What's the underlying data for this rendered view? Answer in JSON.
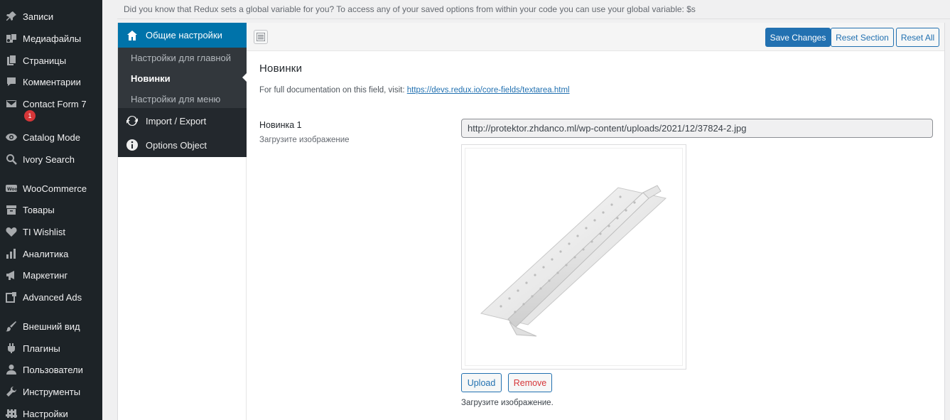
{
  "notice": {
    "text": "Did you know that Redux sets a global variable for you? To access any of your saved options from within your code you can use your global variable: $s"
  },
  "wp_menu": {
    "items": [
      {
        "label": "Записи",
        "icon": "pin-icon"
      },
      {
        "label": "Медиафайлы",
        "icon": "media-icon"
      },
      {
        "label": "Страницы",
        "icon": "page-icon"
      },
      {
        "label": "Комментарии",
        "icon": "comment-icon"
      },
      {
        "label": "Contact Form 7",
        "icon": "envelope-icon",
        "badge": "1"
      },
      {
        "label": "Catalog Mode",
        "icon": "eye-icon"
      },
      {
        "label": "Ivory Search",
        "icon": "search-icon"
      },
      {
        "label": "WooCommerce",
        "icon": "woo-icon"
      },
      {
        "label": "Товары",
        "icon": "archive-icon"
      },
      {
        "label": "TI Wishlist",
        "icon": "heart-icon"
      },
      {
        "label": "Аналитика",
        "icon": "bar-chart-icon"
      },
      {
        "label": "Маркетинг",
        "icon": "megaphone-icon"
      },
      {
        "label": "Advanced Ads",
        "icon": "ads-icon"
      },
      {
        "label": "Внешний вид",
        "icon": "brush-icon"
      },
      {
        "label": "Плагины",
        "icon": "plugin-icon"
      },
      {
        "label": "Пользователи",
        "icon": "user-icon"
      },
      {
        "label": "Инструменты",
        "icon": "wrench-icon"
      },
      {
        "label": "Настройки",
        "icon": "settings-icon"
      }
    ]
  },
  "redux_nav": {
    "active_section": {
      "label": "Общие настройки",
      "icon": "home-icon"
    },
    "subsections": [
      {
        "label": "Настройки для главной",
        "current": false
      },
      {
        "label": "Новинки",
        "current": true
      },
      {
        "label": "Настройки для меню",
        "current": false
      }
    ],
    "sections": [
      {
        "label": "Import / Export",
        "icon": "refresh-icon"
      },
      {
        "label": "Options Object",
        "icon": "info-icon"
      }
    ]
  },
  "toolbar": {
    "save_label": "Save Changes",
    "reset_section_label": "Reset Section",
    "reset_all_label": "Reset All"
  },
  "section": {
    "title": "Новинки",
    "doc_prefix": "For full documentation on this field, visit: ",
    "doc_link": "https://devs.redux.io/core-fields/textarea.html"
  },
  "field": {
    "title": "Новинка 1",
    "subtitle": "Загрузите изображение",
    "url_value": "http://protektor.zhdanco.ml/wp-content/uploads/2021/12/37824-2.jpg",
    "upload_label": "Upload",
    "remove_label": "Remove",
    "description": "Загрузите изображение."
  },
  "colors": {
    "wp_sidebar_bg": "#1d2327",
    "redux_active": "#0073aa",
    "primary_button": "#2271b1",
    "remove_text": "#d63638"
  }
}
